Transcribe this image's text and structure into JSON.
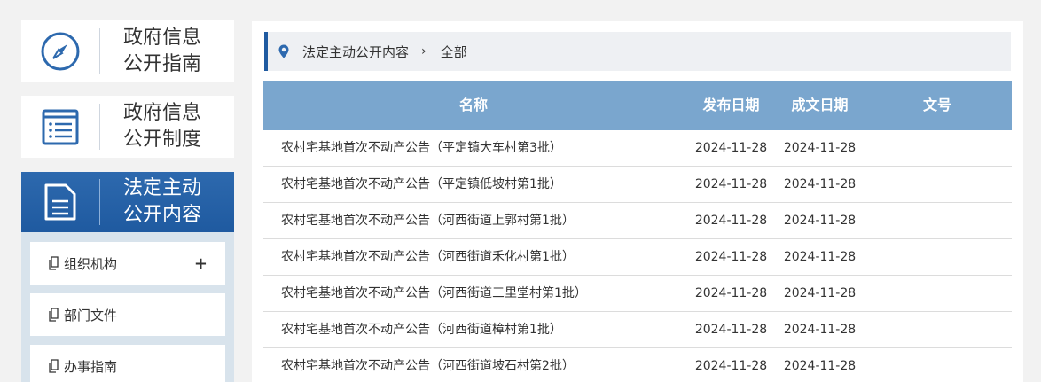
{
  "sidebar": {
    "cards": [
      {
        "line1": "政府信息",
        "line2": "公开指南"
      },
      {
        "line1": "政府信息",
        "line2": "公开制度"
      },
      {
        "line1": "法定主动",
        "line2": "公开内容"
      }
    ],
    "sub_items": [
      {
        "label": "组织机构",
        "expand": "+"
      },
      {
        "label": "部门文件"
      },
      {
        "label": "办事指南"
      }
    ]
  },
  "breadcrumb": {
    "section": "法定主动公开内容",
    "separator": "›",
    "current": "全部"
  },
  "table": {
    "headers": {
      "name": "名称",
      "publish_date": "发布日期",
      "creation_date": "成文日期",
      "doc_no": "文号"
    },
    "rows": [
      {
        "name": "农村宅基地首次不动产公告（平定镇大车村第3批）",
        "publish_date": "2024-11-28",
        "creation_date": "2024-11-28",
        "doc_no": ""
      },
      {
        "name": "农村宅基地首次不动产公告（平定镇低坡村第1批）",
        "publish_date": "2024-11-28",
        "creation_date": "2024-11-28",
        "doc_no": ""
      },
      {
        "name": "农村宅基地首次不动产公告（河西街道上郭村第1批）",
        "publish_date": "2024-11-28",
        "creation_date": "2024-11-28",
        "doc_no": ""
      },
      {
        "name": "农村宅基地首次不动产公告（河西街道禾化村第1批）",
        "publish_date": "2024-11-28",
        "creation_date": "2024-11-28",
        "doc_no": ""
      },
      {
        "name": "农村宅基地首次不动产公告（河西街道三里堂村第1批）",
        "publish_date": "2024-11-28",
        "creation_date": "2024-11-28",
        "doc_no": ""
      },
      {
        "name": "农村宅基地首次不动产公告（河西街道樟村第1批）",
        "publish_date": "2024-11-28",
        "creation_date": "2024-11-28",
        "doc_no": ""
      },
      {
        "name": "农村宅基地首次不动产公告（河西街道坡石村第2批）",
        "publish_date": "2024-11-28",
        "creation_date": "2024-11-28",
        "doc_no": ""
      }
    ]
  },
  "colors": {
    "accent": "#1f5aa0",
    "table_header": "#7aa6ce",
    "icon_blue": "#2d69ae"
  }
}
